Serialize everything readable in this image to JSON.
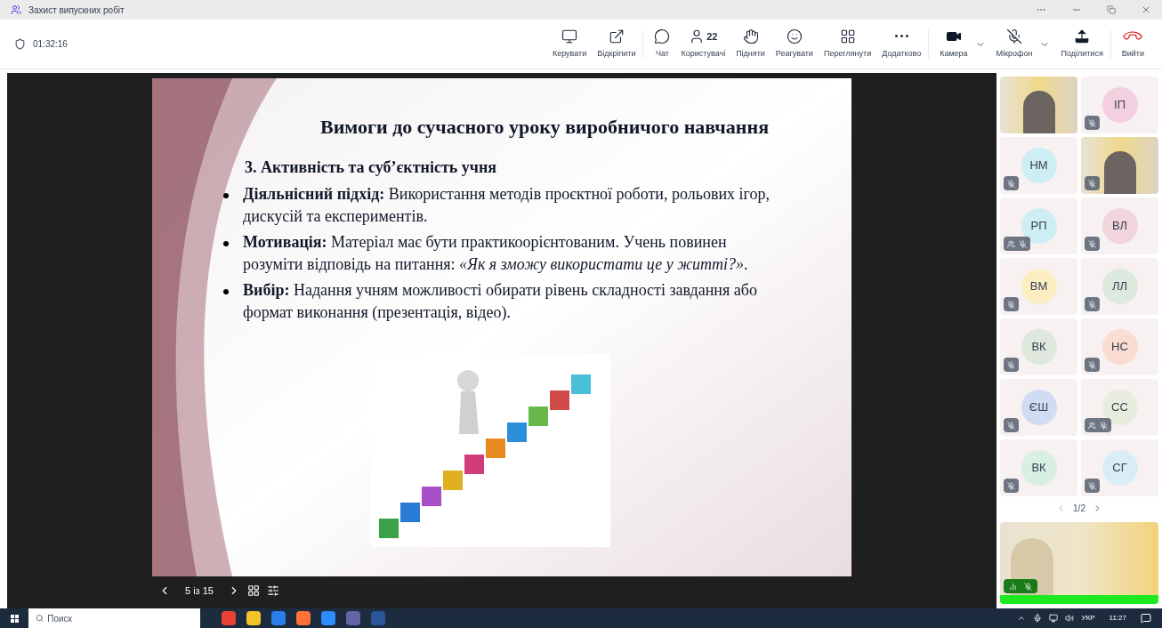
{
  "window": {
    "title": "Захист випускних робіт"
  },
  "meeting": {
    "timer": "01:32:16"
  },
  "toolbar": [
    {
      "kind": "share-screen",
      "label": "Керувати"
    },
    {
      "kind": "popout",
      "label": "Відкріпити"
    },
    {
      "kind": "chat",
      "label": "Чат"
    },
    {
      "kind": "people",
      "label": "Користувачі",
      "count": "22"
    },
    {
      "kind": "hand",
      "label": "Підняти"
    },
    {
      "kind": "smile",
      "label": "Реагувати"
    },
    {
      "kind": "grid",
      "label": "Переглянути"
    },
    {
      "kind": "more",
      "label": "Додатково"
    },
    {
      "kind": "camera",
      "label": "Камера",
      "dropdown": true
    },
    {
      "kind": "mic",
      "label": "Мікрофон",
      "dropdown": true,
      "muted": true
    },
    {
      "kind": "share",
      "label": "Поділитися"
    },
    {
      "kind": "leave",
      "label": "Вийти"
    }
  ],
  "slide": {
    "title": "Вимоги до сучасного уроку виробничого навчання",
    "subtitle": "3. Активність та суб’єктність учня",
    "bullets": [
      "**Діяльнісний підхід:** Використання методів проєктної роботи, рольових ігор, дискусій та експериментів.",
      "**Мотивація:** Матеріал має бути практикоорієнтованим. Учень повинен розуміти відповідь на питання: *«Як я зможу використати це у житті?»*.",
      "**Вибір:** Надання учням можливості обирати рівень складності завдання або формат виконання (презентація, відео)."
    ]
  },
  "slide_nav": {
    "position": "5 із 15"
  },
  "participants": [
    {
      "kind": "video",
      "muted": false,
      "extra": false
    },
    {
      "kind": "avatar",
      "initials": "ІП",
      "color": "#f3d0e0",
      "muted": true,
      "extra": false
    },
    {
      "kind": "avatar",
      "initials": "НМ",
      "color": "#cdeef3",
      "muted": true,
      "extra": false
    },
    {
      "kind": "video",
      "muted": true,
      "extra": false
    },
    {
      "kind": "avatar",
      "initials": "РП",
      "color": "#cdeef3",
      "muted": true,
      "extra": true
    },
    {
      "kind": "avatar",
      "initials": "ВЛ",
      "color": "#f1d4dc",
      "muted": true,
      "extra": false
    },
    {
      "kind": "avatar",
      "initials": "ВМ",
      "color": "#fbefc2",
      "muted": true,
      "extra": false
    },
    {
      "kind": "avatar",
      "initials": "ЛЛ",
      "color": "#dde9dc",
      "muted": true,
      "extra": false
    },
    {
      "kind": "avatar",
      "initials": "ВК",
      "color": "#dfe8dc",
      "muted": true,
      "extra": false
    },
    {
      "kind": "avatar",
      "initials": "НС",
      "color": "#fbdcd2",
      "muted": true,
      "extra": false
    },
    {
      "kind": "avatar",
      "initials": "ЄШ",
      "color": "#cfdcf2",
      "muted": true,
      "extra": false
    },
    {
      "kind": "avatar",
      "initials": "СС",
      "color": "#e8ecdc",
      "muted": true,
      "extra": true
    },
    {
      "kind": "avatar",
      "initials": "ВК",
      "color": "#d8efe3",
      "muted": true,
      "extra": false
    },
    {
      "kind": "avatar",
      "initials": "СГ",
      "color": "#d8eef4",
      "muted": true,
      "extra": false
    }
  ],
  "pager": {
    "label": "1/2"
  },
  "self_view": {
    "speaking": true,
    "muted": true
  },
  "taskbar": {
    "search": {
      "placeholder": "Поиск"
    },
    "language": "УКР",
    "time": "11:27"
  }
}
